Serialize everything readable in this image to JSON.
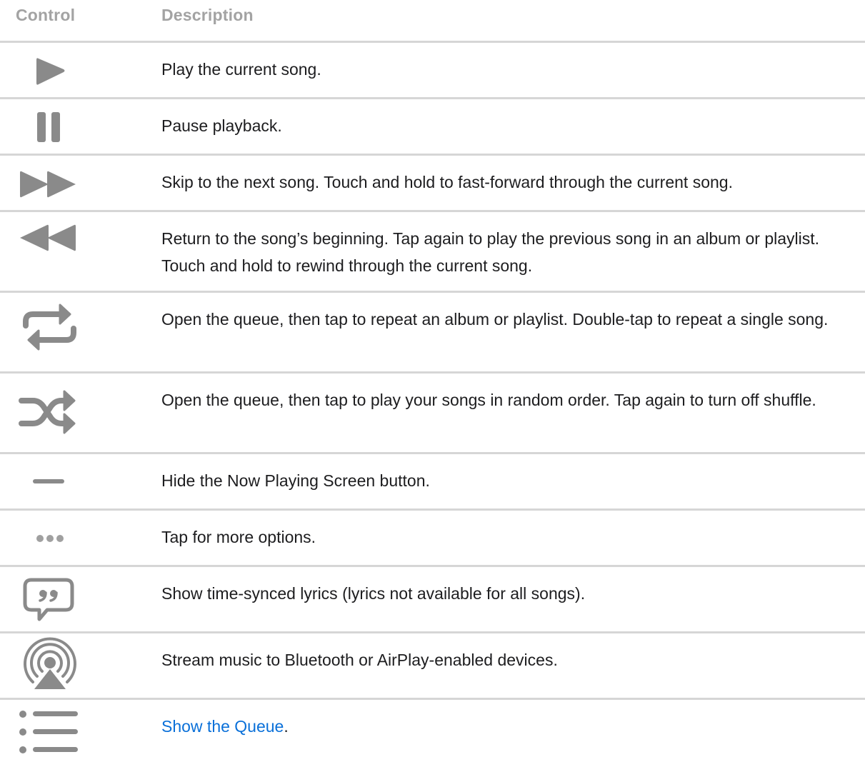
{
  "header": {
    "control": "Control",
    "description": "Description"
  },
  "icon_color": "#8a8a8a",
  "link_color": "#0a70d9",
  "rows": [
    {
      "icon": "play-icon",
      "description": "Play the current song."
    },
    {
      "icon": "pause-icon",
      "description": "Pause playback."
    },
    {
      "icon": "fast-forward-icon",
      "description": "Skip to the next song. Touch and hold to fast-forward through the current song."
    },
    {
      "icon": "rewind-icon",
      "description": "Return to the song’s beginning. Tap again to play the previous song in an album or playlist. Touch and hold to rewind through the current song."
    },
    {
      "icon": "repeat-icon",
      "description": "Open the queue, then tap to repeat an album or playlist. Double-tap to repeat a single song."
    },
    {
      "icon": "shuffle-icon",
      "description": "Open the queue, then tap to play your songs in random order. Tap again to turn off shuffle."
    },
    {
      "icon": "minimize-dash-icon",
      "description": "Hide the Now Playing Screen button."
    },
    {
      "icon": "more-options-icon",
      "description": "Tap for more options."
    },
    {
      "icon": "lyrics-icon",
      "description": "Show time-synced lyrics (lyrics not available for all songs)."
    },
    {
      "icon": "airplay-icon",
      "description": "Stream music to Bluetooth or AirPlay-enabled devices."
    },
    {
      "icon": "queue-list-icon",
      "link_text": "Show the Queue",
      "suffix": "."
    }
  ]
}
